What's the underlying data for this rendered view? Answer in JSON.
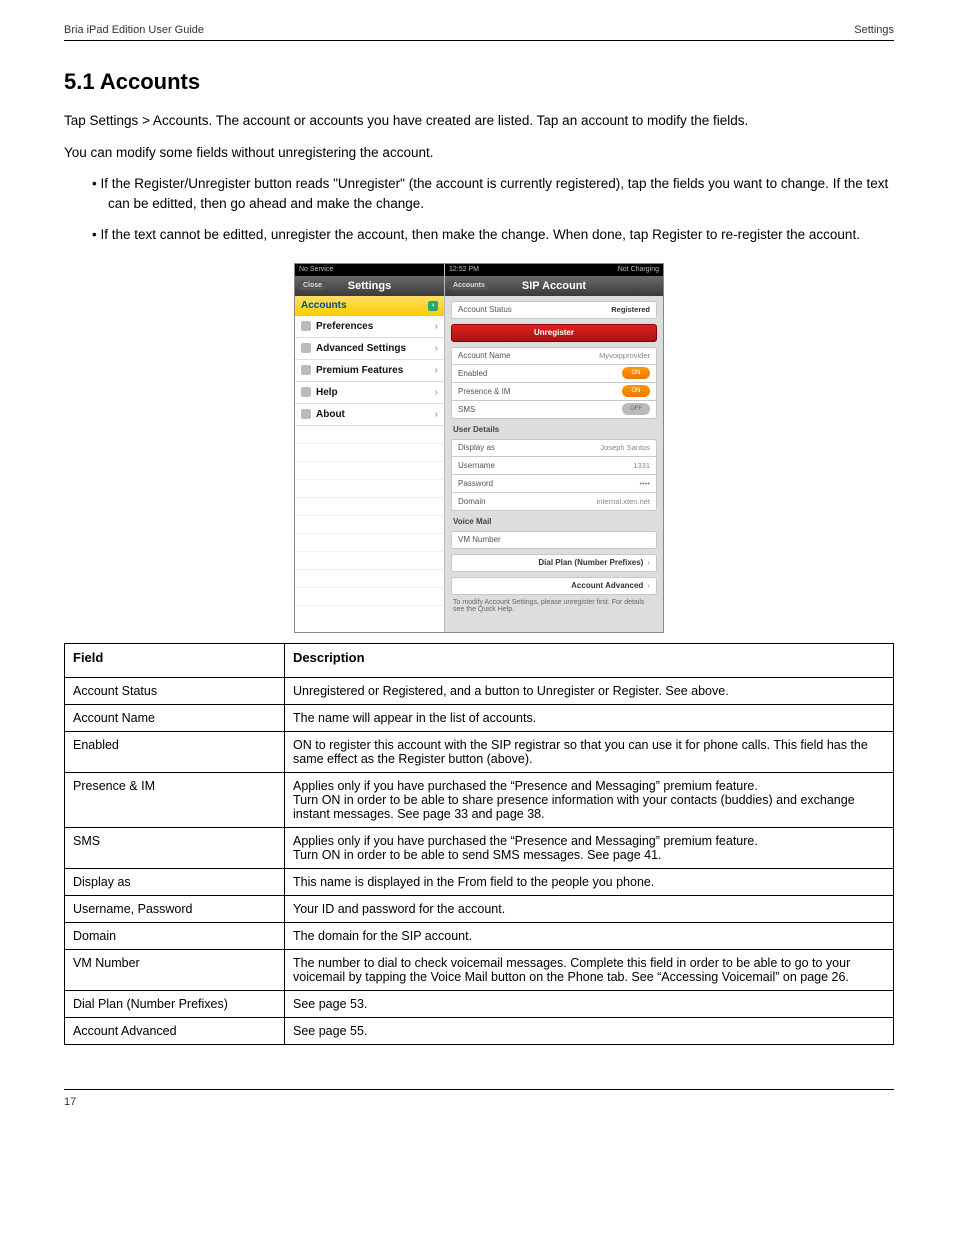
{
  "running_head": {
    "left": "Bria iPad Edition User Guide",
    "right": "Settings"
  },
  "footer": {
    "left": "17",
    "right": ""
  },
  "section_title": "5.1 Accounts",
  "paragraphs": {
    "p1": "Tap Settings > Accounts. The account or accounts you have created are listed. Tap an account to modify the fields.",
    "p2": "You can modify some fields without unregistering the account.",
    "p3": "If the Register/Unregister button reads \"Unregister\" (the account is currently registered), tap the fields you want to change. If the text can be editted, then go ahead and make the change.",
    "p4": "If the text cannot be editted, unregister the account, then make the change. When done, tap Register to re-register the account."
  },
  "screenshot": {
    "left_status": "No Service",
    "right_status_time": "12:52 PM",
    "right_status_right": "Not Charging",
    "settings_title": "Settings",
    "close_label": "Close",
    "accounts_item": "Accounts",
    "menu": [
      {
        "label": "Preferences"
      },
      {
        "label": "Advanced Settings"
      },
      {
        "label": "Premium Features"
      },
      {
        "label": "Help"
      },
      {
        "label": "About"
      }
    ],
    "right_back": "Accounts",
    "right_title": "SIP Account",
    "rows": {
      "status_label": "Account Status",
      "status_value": "Registered",
      "unregister": "Unregister",
      "account_name_label": "Account Name",
      "account_name_value": "Myvoipprovider",
      "enabled_label": "Enabled",
      "presence_label": "Presence & IM",
      "sms_label": "SMS",
      "on": "ON",
      "off": "OFF",
      "user_details": "User Details",
      "display_as_label": "Display as",
      "display_as_value": "Joseph Santos",
      "username_label": "Username",
      "username_value": "1331",
      "password_label": "Password",
      "password_value": "••••",
      "domain_label": "Domain",
      "domain_value": "internal.xten.net",
      "voicemail": "Voice Mail",
      "vm_number_label": "VM Number",
      "dial_plan_link": "Dial Plan (Number Prefixes)",
      "account_adv_link": "Account Advanced",
      "note": "To modify Account Settings, please unregister first.  For details see the Quick Help."
    }
  },
  "table": {
    "head_field": "Field",
    "head_desc": "Description",
    "rows": [
      {
        "field": "Account Status",
        "desc": "Unregistered or Registered, and a button to Unregister or Register. See above."
      },
      {
        "field": "Account Name",
        "desc": "The name will appear in the list of accounts."
      },
      {
        "field": "Enabled",
        "desc": "ON to register this account with the SIP registrar so that you can use it for phone calls. This field has the same effect as the Register button (above)."
      },
      {
        "field": "Presence & IM",
        "desc": "Applies only if you have purchased the “Presence and Messaging” premium feature.\nTurn ON in order to be able to share presence information with your contacts (buddies) and exchange instant messages. See page 33 and page 38."
      },
      {
        "field": "SMS",
        "desc": "Applies only if you have purchased the “Presence and Messaging” premium feature.\nTurn ON in order to be able to send SMS messages. See page 41."
      },
      {
        "field": "Display as",
        "desc": "This name is displayed in the From field to the people you phone."
      },
      {
        "field": "Username, Password",
        "desc": "Your ID and password for the account."
      },
      {
        "field": "Domain",
        "desc": "The domain for the SIP account."
      },
      {
        "field": "VM Number",
        "desc": "The number to dial to check voicemail messages. Complete this field in order to be able to go to your voicemail by tapping the Voice Mail button on the Phone tab. See “Accessing Voicemail” on page 26."
      },
      {
        "field": "Dial Plan (Number Prefixes)",
        "desc": "See page 53."
      },
      {
        "field": "Account Advanced",
        "desc": "See page 55."
      }
    ]
  }
}
